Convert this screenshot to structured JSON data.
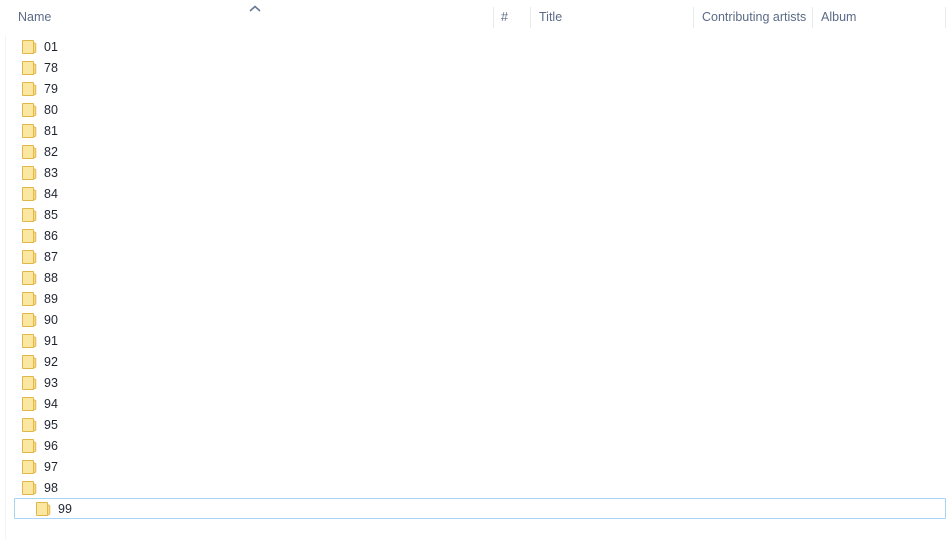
{
  "window": {
    "view": "file-explorer-details-list",
    "background": "#ffffff"
  },
  "columns": {
    "name": "Name",
    "number": "#",
    "title": "Title",
    "contributing_artists": "Contributing artists",
    "album": "Album",
    "sort": {
      "column": "Name",
      "direction": "ascending",
      "icon": "chevron-up-icon"
    }
  },
  "colors": {
    "header_text": "#5b6b86",
    "row_text": "#1f2430",
    "selection_border": "#a8d5f5",
    "folder_fill": "#fbe7a2",
    "folder_border": "#e0b646",
    "separator": "#e8eaee"
  },
  "rows": [
    {
      "name": "01",
      "icon": "folder-icon",
      "selected": false
    },
    {
      "name": "78",
      "icon": "folder-icon",
      "selected": false
    },
    {
      "name": "79",
      "icon": "folder-icon",
      "selected": false
    },
    {
      "name": "80",
      "icon": "folder-icon",
      "selected": false
    },
    {
      "name": "81",
      "icon": "folder-icon",
      "selected": false
    },
    {
      "name": "82",
      "icon": "folder-icon",
      "selected": false
    },
    {
      "name": "83",
      "icon": "folder-icon",
      "selected": false
    },
    {
      "name": "84",
      "icon": "folder-icon",
      "selected": false
    },
    {
      "name": "85",
      "icon": "folder-icon",
      "selected": false
    },
    {
      "name": "86",
      "icon": "folder-icon",
      "selected": false
    },
    {
      "name": "87",
      "icon": "folder-icon",
      "selected": false
    },
    {
      "name": "88",
      "icon": "folder-icon",
      "selected": false
    },
    {
      "name": "89",
      "icon": "folder-icon",
      "selected": false
    },
    {
      "name": "90",
      "icon": "folder-icon",
      "selected": false
    },
    {
      "name": "91",
      "icon": "folder-icon",
      "selected": false
    },
    {
      "name": "92",
      "icon": "folder-icon",
      "selected": false
    },
    {
      "name": "93",
      "icon": "folder-icon",
      "selected": false
    },
    {
      "name": "94",
      "icon": "folder-icon",
      "selected": false
    },
    {
      "name": "95",
      "icon": "folder-icon",
      "selected": false
    },
    {
      "name": "96",
      "icon": "folder-icon",
      "selected": false
    },
    {
      "name": "97",
      "icon": "folder-icon",
      "selected": false
    },
    {
      "name": "98",
      "icon": "folder-icon",
      "selected": false
    },
    {
      "name": "99",
      "icon": "folder-icon",
      "selected": true
    }
  ]
}
